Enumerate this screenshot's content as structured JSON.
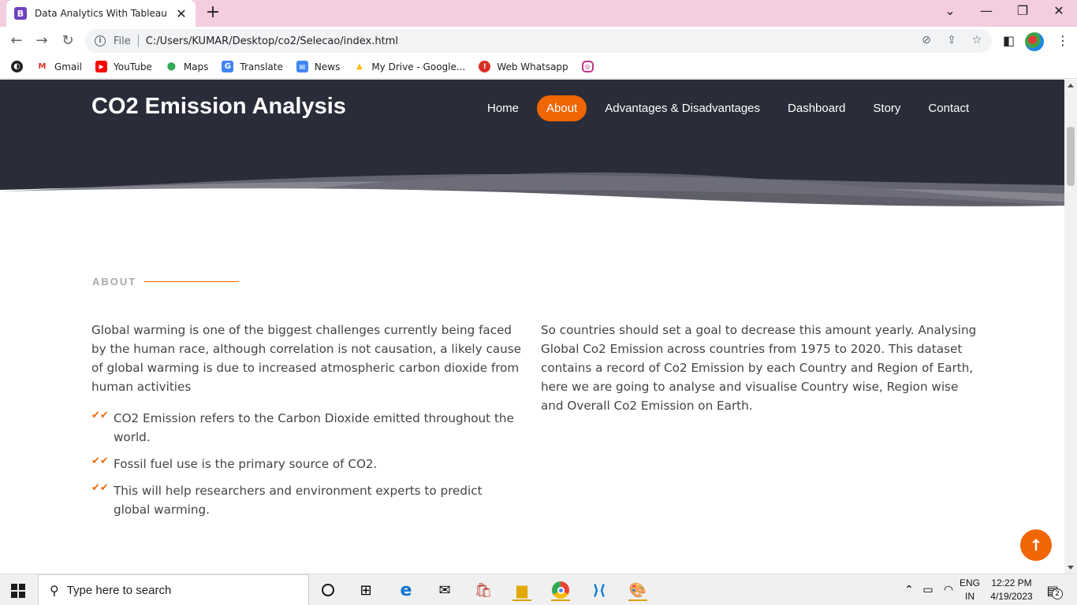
{
  "browser": {
    "tab_title": "Data Analytics With Tableau",
    "tab_favicon": "B",
    "omnibox_scheme": "File",
    "url": "C:/Users/KUMAR/Desktop/co2/Selecao/index.html",
    "bookmarks": [
      {
        "label": "Gmail",
        "icon": "gmail-icon"
      },
      {
        "label": "YouTube",
        "icon": "youtube-icon"
      },
      {
        "label": "Maps",
        "icon": "maps-icon"
      },
      {
        "label": "Translate",
        "icon": "translate-icon"
      },
      {
        "label": "News",
        "icon": "news-icon"
      },
      {
        "label": "My Drive - Google...",
        "icon": "drive-icon"
      },
      {
        "label": "Web Whatsapp",
        "icon": "whatsapp-icon"
      }
    ]
  },
  "site": {
    "brand": "CO2 Emission Analysis",
    "nav": [
      {
        "label": "Home",
        "active": false
      },
      {
        "label": "About",
        "active": true
      },
      {
        "label": "Advantages & Disadvantages",
        "active": false
      },
      {
        "label": "Dashboard",
        "active": false
      },
      {
        "label": "Story",
        "active": false
      },
      {
        "label": "Contact",
        "active": false
      }
    ],
    "accent_color": "#ef6603",
    "header_color": "#2a2c39"
  },
  "about": {
    "section_title": "ABOUT",
    "left_paragraph": "Global warming is one of the biggest challenges currently being faced by the human race, although correlation is not causation, a likely cause of global warming is due to increased atmospheric carbon dioxide from human activities",
    "points": [
      "CO2 Emission refers to the Carbon Dioxide emitted throughout the world.",
      "Fossil fuel use is the primary source of CO2.",
      "This will help researchers and environment experts to predict global warming."
    ],
    "right_paragraph": "So countries should set a goal to decrease this amount yearly. Analysing Global Co2 Emission across countries from 1975 to 2020. This dataset contains a record of Co2 Emission by each Country and Region of Earth, here we are going to analyse and visualise Country wise, Region wise and Overall Co2 Emission on Earth."
  },
  "taskbar": {
    "search_placeholder": "Type here to search",
    "language": "ENG",
    "region": "IN",
    "time": "12:22 PM",
    "date": "4/19/2023",
    "notification_count": "2"
  }
}
